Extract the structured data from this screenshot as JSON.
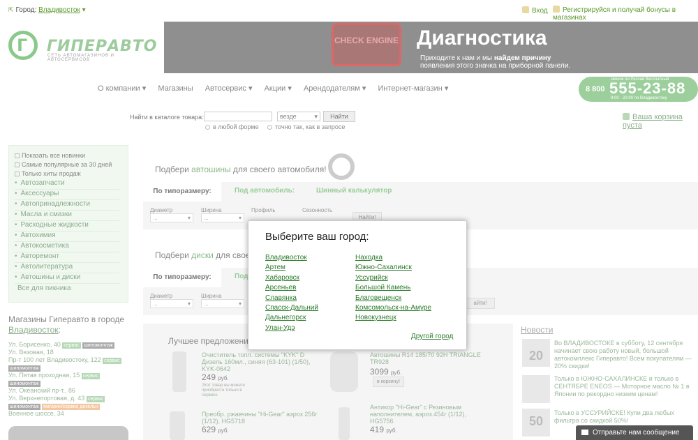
{
  "topbar": {
    "city_label": "Город:",
    "city_value": "Владивосток",
    "login": "Вход",
    "register": "Регистрируйся и получай бонусы в магазинах"
  },
  "logo": {
    "name": "ГИПЕРАВТО",
    "sub": "СЕТЬ АВТОМАГАЗИНОВ И АВТОСЕРВИСОВ"
  },
  "banner": {
    "engine_text": "CHECK ENGINE",
    "title": "Диагностика",
    "line1_pre": "Приходите к нам и мы ",
    "line1_bold": "найдем причину",
    "line2": "появления этого значка на приборной панели."
  },
  "nav": {
    "items": [
      "О компании ▾",
      "Магазины",
      "Автосервис ▾",
      "Акции ▾",
      "Арендодателям ▾",
      "Интернет-магазин ▾"
    ]
  },
  "phone": {
    "prefix": "8 800",
    "number": "555-23-88",
    "note_top": "звонок по России бесплатный",
    "note_bottom": "9:00 - 22:00 по Владивостоку"
  },
  "search": {
    "label": "Найти в каталоге товара:",
    "select": "везде",
    "button": "Найти",
    "opt1": "в любой форме",
    "opt2": "точно так, как в запросе"
  },
  "cart": {
    "label": "Ваша корзина пуста"
  },
  "sidebar": {
    "checks": [
      "Показать все новинки",
      "Самые популярные за 30 дней",
      "Только хиты продаж"
    ],
    "items": [
      "Автозапчасти",
      "Аксессуары",
      "Автопринадлежности",
      "Масла и смазки",
      "Расходные жидкости",
      "Автохимия",
      "Автокосметика",
      "Авторемонт",
      "Автолитература",
      "Автошины и диски"
    ],
    "all": "Все для пикника",
    "shops_title": "Магазины Гиперавто в городе",
    "shops_city": "Владивосток",
    "shops_colon": ":",
    "shops": [
      {
        "addr": "Ул. Борисенко, 40",
        "tags": [
          "сервис",
          "шиномонтаж"
        ]
      },
      {
        "addr": "Ул. Вязовая, 18",
        "tags": []
      },
      {
        "addr": "Пр-т 100 лет Владивостоку, 122",
        "tags": [
          "сервис",
          "шиномонтаж"
        ]
      },
      {
        "addr": "Ул. Пятая проходная, 15",
        "tags": [
          "сервис",
          "шиномонтаж"
        ]
      },
      {
        "addr": "Ул. Океанский пр-т., 86",
        "tags": []
      },
      {
        "addr": "Ул. Верхнепортовая, д. 43",
        "tags": [
          "сервис",
          "шиномонтаж",
          "магазин/сервис дизельн"
        ]
      },
      {
        "addr": "Военное шоссе, 34",
        "tags": []
      }
    ]
  },
  "tires": {
    "pre": "Подбери ",
    "link": "автошины",
    "post": " для своего автомобиля!",
    "tab_active": "По типоразмеру:",
    "tab2": "Под автомобиль:",
    "tab3": "Шинный калькулятор",
    "filters": [
      "Диаметр",
      "Ширина",
      "Профиль",
      "Сезонность"
    ],
    "select_val": "...",
    "button": "Найти!"
  },
  "disks": {
    "pre": "Подбери ",
    "link": "диски",
    "post": " для свое",
    "tab_active": "По типоразмеру:",
    "tab2": "Под",
    "filters": [
      "Диаметр",
      "Ширина"
    ],
    "select_val": "...",
    "button": "айти!"
  },
  "best": {
    "title": "Лучшее предложени",
    "products": [
      {
        "name": "Очиститель топл. системы \"KYK\" D Дизель 160мл., синяя (63-101) (1/50), KYK-0642",
        "price": "249",
        "unit": "руб.",
        "note": "Этот товар вы можете приобрести только в",
        "note_link": "сервисе"
      },
      {
        "name": "Автошины R14 185/70 92H TRIANGLE TR928",
        "price": "3099",
        "unit": "руб.",
        "button": "в корзину!"
      },
      {
        "name": "Преобр. ржавчины \"Hi-Gear\" аэроз 256г (1/12), HG5718",
        "price": "629",
        "unit": "руб."
      },
      {
        "name": "Антикор \"Hi-Gear\" с Резиновым наполнителем, аэроз.454г (1/12), HG5756",
        "price": "419",
        "unit": "руб."
      }
    ]
  },
  "news": {
    "title": "Новости",
    "items": [
      {
        "text": "Во ВЛАДИВОСТОКЕ в субботу, 12 сентября начинает свою работу новый, большой автокомплекс Гиперавто! Всем покупателям — 20% скидки!",
        "badge": "20"
      },
      {
        "text": "Только в ЮЖНО-САХАЛИНСКЕ и только в СЕНТЯБРЕ ENEOS — Моторное масло № 1 в Японии по рекордно низким ценам!",
        "badge": ""
      },
      {
        "text": "Только в УССУРИЙСКЕ! Купи два любых фильтра со скидкой 50%!",
        "badge": "50"
      }
    ]
  },
  "chat": {
    "label": "Отправьте нам сообщение"
  },
  "modal": {
    "title": "Выберите ваш город:",
    "col1": [
      "Владивосток",
      "Артем",
      "Хабаровск",
      "Арсеньев",
      "Славянка",
      "Спасск-Дальний",
      "Дальнегорск",
      "Улан-Удэ"
    ],
    "col2": [
      "Находка",
      "Южно-Сахалинск",
      "Уссурийск",
      "Большой Камень",
      "Благовещенск",
      "Комсомольск-на-Амуре",
      "Новокузнецк"
    ],
    "other": "Другой город"
  }
}
